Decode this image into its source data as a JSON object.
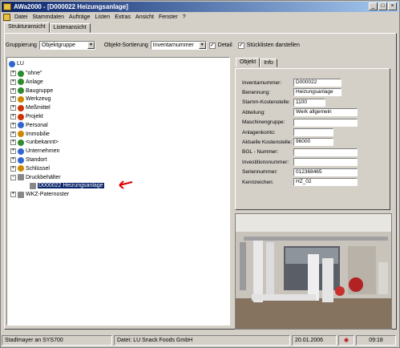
{
  "window": {
    "title": "AWa2000 - [D000022 Heizungsanlage]"
  },
  "window_controls": {
    "minimize": "_",
    "maximize": "□",
    "close": "×"
  },
  "menu": [
    "Datei",
    "Stammdaten",
    "Aufträge",
    "Listen",
    "Extras",
    "Ansicht",
    "Fenster",
    "?"
  ],
  "tabs": [
    "Strukturansicht",
    "Listenansicht"
  ],
  "options": {
    "grouping_label": "Gruppierung",
    "grouping_value": "Objektgruppe",
    "sort_label": "Objekt-Sortierung",
    "sort_value": "Inventarnummer",
    "detail_label": "Detail",
    "detail_checked": "✓",
    "bom_label": "Stücklisten darstellen",
    "bom_checked": "✓"
  },
  "tree": {
    "root": "LU",
    "items": [
      {
        "label": "\"ohne\"",
        "color": "#2e8b2e"
      },
      {
        "label": "Anlage",
        "color": "#2e8b2e"
      },
      {
        "label": "Baugruppe",
        "color": "#2e8b2e"
      },
      {
        "label": "Werkzeug",
        "color": "#cc8800"
      },
      {
        "label": "Meßmittel",
        "color": "#cc3300"
      },
      {
        "label": "Projekt",
        "color": "#cc3300"
      },
      {
        "label": "Personal",
        "color": "#3366cc"
      },
      {
        "label": "Immobilie",
        "color": "#cc8800"
      },
      {
        "label": "<unbekannt>",
        "color": "#2e8b2e"
      },
      {
        "label": "Unternehmen",
        "color": "#3366cc"
      },
      {
        "label": "Standort",
        "color": "#3366cc"
      },
      {
        "label": "Schlüssel",
        "color": "#cc8800"
      },
      {
        "label": "Druckbehälter",
        "color": "#888888"
      },
      {
        "label": "D000022 Heizungsanlage",
        "color": "#888888"
      },
      {
        "label": "WKZ-Paternoster",
        "color": "#888888"
      }
    ]
  },
  "detail_tabs": [
    "Objekt",
    "Info"
  ],
  "fields": [
    {
      "label": "Inventarnummer:",
      "value": "D000022"
    },
    {
      "label": "Benennung:",
      "value": "Heizungsanlage"
    },
    {
      "label": "Stamm-Kostenstelle:",
      "value": "1100"
    },
    {
      "label": "Abteilung:",
      "value": "Werk allgemein"
    },
    {
      "label": "Maschinengruppe:",
      "value": ""
    },
    {
      "label": "Anlagenkonto:",
      "value": ""
    },
    {
      "label": "Aktuelle Kostenstelle:",
      "value": "96000"
    },
    {
      "label": "BGL - Nummer:",
      "value": ""
    },
    {
      "label": "Investitionsnummer:",
      "value": ""
    },
    {
      "label": "Seriennummer:",
      "value": "012368465"
    },
    {
      "label": "Kennzeichen:",
      "value": "HZ_02"
    }
  ],
  "status": {
    "user": "Stadlmayer an SYS700",
    "file": "Datei: LU Snack Foods GmbH",
    "date": "20.01.2006",
    "time": "09:18"
  },
  "colors": {
    "titlebar": "#0a246a",
    "selection": "#0a246a",
    "arrow": "#e00000"
  }
}
